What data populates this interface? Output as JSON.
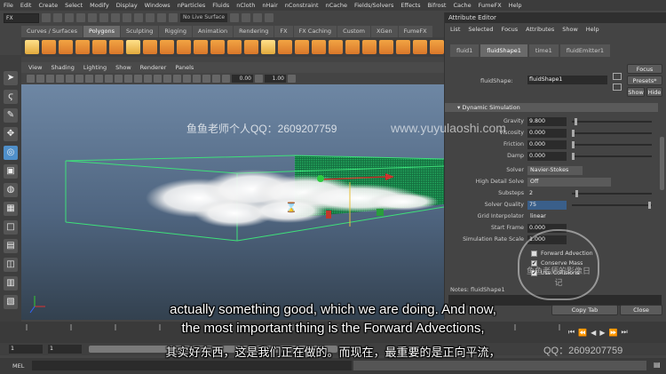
{
  "menubar": [
    "File",
    "Edit",
    "Create",
    "Select",
    "Modify",
    "Display",
    "Windows",
    "nParticles",
    "Fluids",
    "nCloth",
    "nHair",
    "nConstraint",
    "nCache",
    "Fields/Solvers",
    "Effects",
    "Bifrost",
    "Cache",
    "FumeFX",
    "Help"
  ],
  "statusline": {
    "mode": "FX",
    "live_surface": "No Live Surface"
  },
  "shelf_tabs": [
    {
      "label": "Curves / Surfaces",
      "active": false
    },
    {
      "label": "Polygons",
      "active": true
    },
    {
      "label": "Sculpting",
      "active": false
    },
    {
      "label": "Rigging",
      "active": false
    },
    {
      "label": "Animation",
      "active": false
    },
    {
      "label": "Rendering",
      "active": false
    },
    {
      "label": "FX",
      "active": false
    },
    {
      "label": "FX Caching",
      "active": false
    },
    {
      "label": "Custom",
      "active": false
    },
    {
      "label": "XGen",
      "active": false
    },
    {
      "label": "FumeFX",
      "active": false
    }
  ],
  "viewport": {
    "menu": [
      "View",
      "Shading",
      "Lighting",
      "Show",
      "Renderer",
      "Panels"
    ],
    "field_a": "0.00",
    "field_b": "1.00"
  },
  "attribute_editor": {
    "title": "Attribute Editor",
    "menu": [
      "List",
      "Selected",
      "Focus",
      "Attributes",
      "Show",
      "Help"
    ],
    "tabs": [
      {
        "label": "fluid1",
        "active": false
      },
      {
        "label": "fluidShape1",
        "active": true
      },
      {
        "label": "time1",
        "active": false
      },
      {
        "label": "fluidEmitter1",
        "active": false
      }
    ],
    "node_label": "fluidShape:",
    "node_value": "fluidShape1",
    "focus_label": "Focus",
    "presets_label": "Presets*",
    "show_label": "Show",
    "hide_label": "Hide",
    "section": "Dynamic Simulation",
    "attrs": {
      "gravity": {
        "label": "Gravity",
        "value": "9.800"
      },
      "viscosity": {
        "label": "Viscosity",
        "value": "0.000"
      },
      "friction": {
        "label": "Friction",
        "value": "0.000"
      },
      "damp": {
        "label": "Damp",
        "value": "0.000"
      },
      "solver": {
        "label": "Solver",
        "value": "Navier-Stokes"
      },
      "high_detail": {
        "label": "High Detail Solve",
        "value": "Off"
      },
      "substeps": {
        "label": "Substeps",
        "value": "2"
      },
      "solver_quality": {
        "label": "Solver Quality",
        "value": "75"
      },
      "grid_interp": {
        "label": "Grid Interpolator",
        "value": "linear"
      },
      "start_frame": {
        "label": "Start Frame",
        "value": "0.000"
      },
      "sim_rate": {
        "label": "Simulation Rate Scale",
        "value": "1.000"
      }
    },
    "checks": {
      "forward_advection": "Forward Advection",
      "conserve_mass": "Conserve Mass",
      "use_collisions": "Use Collisions"
    },
    "notes_label": "Notes: fluidShape1",
    "copy_tab": "Copy Tab",
    "close": "Close"
  },
  "range": {
    "start_a": "1",
    "start_b": "1"
  },
  "mel_label": "MEL",
  "subtitles": {
    "line1": "actually something good, which we are doing. And now,",
    "line2": "the most important thing is the Forward Advections,",
    "line3": "其实好东西，这是我们正在做的。而现在，最重要的是正向平流，"
  },
  "watermarks": {
    "qq": "鱼鱼老师个人QQ：2609207759",
    "site": "www.yuyulaoshi.com",
    "qq_bottom": "QQ：2609207759",
    "stamp": "鱼鱼老师的影像日记"
  }
}
